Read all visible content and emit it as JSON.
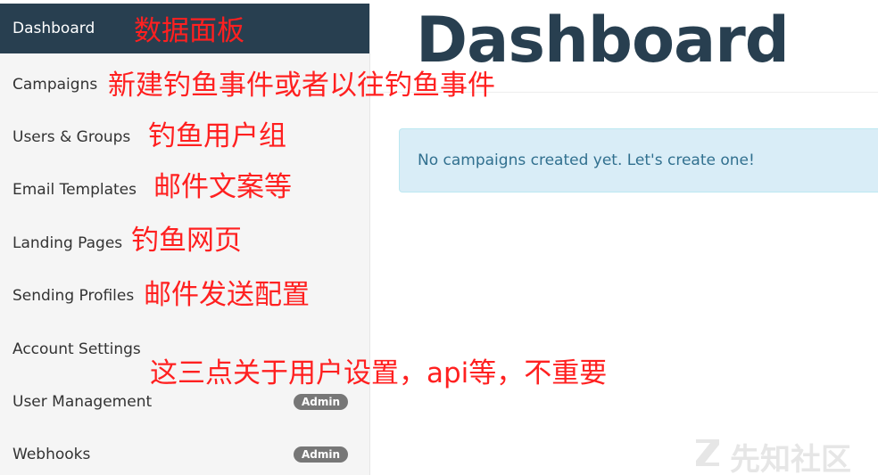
{
  "sidebar": {
    "items": [
      {
        "label": "Dashboard",
        "active": true
      },
      {
        "label": "Campaigns"
      },
      {
        "label": "Users & Groups"
      },
      {
        "label": "Email Templates"
      },
      {
        "label": "Landing Pages"
      },
      {
        "label": "Sending Profiles"
      },
      {
        "label": "Account Settings"
      },
      {
        "label": "User Management",
        "badge": "Admin"
      },
      {
        "label": "Webhooks",
        "badge": "Admin"
      }
    ],
    "active_color": "#283f50"
  },
  "main": {
    "title": "Dashboard",
    "alert_text": "No campaigns created yet. Let's create one!"
  },
  "annotations": {
    "dashboard": "数据面板",
    "campaigns": "新建钓鱼事件或者以往钓鱼事件",
    "users_groups": "钓鱼用户组",
    "email_templates": "邮件文案等",
    "landing_pages": "钓鱼网页",
    "sending_profiles": "邮件发送配置",
    "settings": "这三点关于用户设置，api等，不重要",
    "color": "#ff2020"
  },
  "watermark": {
    "text": "先知社区",
    "icon": "xianzhi-logo-icon"
  }
}
